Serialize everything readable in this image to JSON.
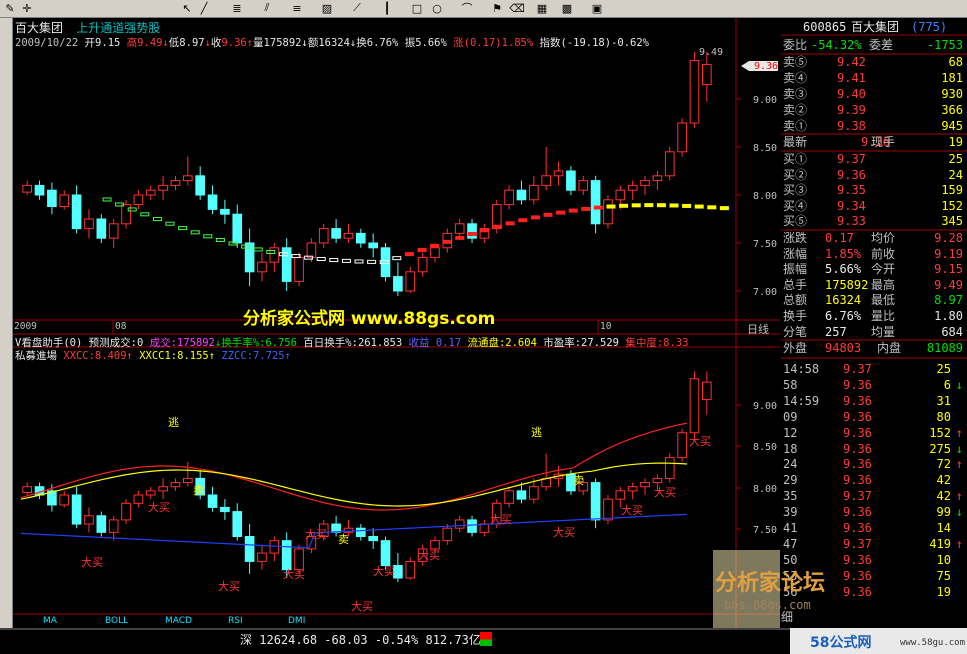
{
  "toolbar": {
    "icons": [
      "pencil-icon",
      "cross-icon",
      "arrow-icon",
      "line-icon",
      "cursor-icon",
      "diagonal-icon",
      "triangle-icon",
      "text-icon",
      "channel-icon",
      "parallel-icon",
      "hatch-icon",
      "bar-icon",
      "flag-icon",
      "rect-icon",
      "ellipse-icon",
      "arc-icon",
      "erase-icon",
      "palette-icon",
      "save-icon"
    ]
  },
  "main_chart": {
    "stock_name": "百大集团",
    "formula_name": "上升通道强势股",
    "info": {
      "date": "2009/10/22",
      "open_label": "开",
      "open": "9.15",
      "high_label": "高",
      "high": "9.49",
      "low_label": "低",
      "low": "8.97",
      "close_label": "收",
      "close": "9.36",
      "vol_label": "量",
      "vol": "175892",
      "amt_label": "额",
      "amt": "16324",
      "turn_label": "换",
      "turn": "6.76%",
      "amp_label": "振",
      "amp": "5.66%",
      "chg_label": "涨",
      "chg": "(0.17)",
      "chg_pct": "1.85%",
      "idx_label": "指数",
      "idx": "(-19.18)-0.62%"
    },
    "price_axis": [
      "9.00",
      "8.50",
      "8.00",
      "7.50",
      "7.00"
    ],
    "peak_label": "9.49",
    "current_tag": "9.36",
    "date_labels": [
      "2009",
      "08",
      "10"
    ],
    "period": "日线",
    "watermark": "分析家公式网 www.88gs.com"
  },
  "indicator_bar": {
    "name": "V看盘助手(0)",
    "forecast_label": "预测成交:0",
    "vol_label": "成交:175892",
    "turn_label": "换手率%:6.756",
    "avg100": "百日换手%:261.853",
    "close_label": "收益 0.17",
    "float_label": "流通盘:2.604",
    "pe_label": "市盈率:27.529",
    "conc_label": "集中度:8.33"
  },
  "lower_chart": {
    "name": "私募進場",
    "xxcc": "XXCC:8.409",
    "xxcc1": "XXCC1:8.155",
    "zzcc": "ZZCC:7.725",
    "price_axis": [
      "9.00",
      "8.50",
      "8.00",
      "7.50"
    ],
    "signals": {
      "buy": "大买",
      "sell": "卖",
      "escape": "逃"
    }
  },
  "tabs": [
    "MA",
    "BOLL",
    "MACD",
    "RSI",
    "DMI"
  ],
  "quote": {
    "code": "600865",
    "name": "百大集团",
    "num": "(775)",
    "weibi_label": "委比",
    "weibi": "-54.32%",
    "weicha_label": "委差",
    "weicha": "-1753",
    "sells": [
      {
        "l": "卖⑤",
        "p": "9.42",
        "v": "68"
      },
      {
        "l": "卖④",
        "p": "9.41",
        "v": "181"
      },
      {
        "l": "卖③",
        "p": "9.40",
        "v": "930"
      },
      {
        "l": "卖②",
        "p": "9.39",
        "v": "366"
      },
      {
        "l": "卖①",
        "p": "9.38",
        "v": "945"
      }
    ],
    "latest_label": "最新",
    "latest": "9.36",
    "xs_label": "现手",
    "xs": "19",
    "buys": [
      {
        "l": "买①",
        "p": "9.37",
        "v": "25"
      },
      {
        "l": "买②",
        "p": "9.36",
        "v": "24"
      },
      {
        "l": "买③",
        "p": "9.35",
        "v": "159"
      },
      {
        "l": "买④",
        "p": "9.34",
        "v": "152"
      },
      {
        "l": "买⑤",
        "p": "9.33",
        "v": "345"
      }
    ],
    "stats": [
      {
        "a": "涨跌",
        "b": "0.17",
        "c": "均价",
        "d": "9.28"
      },
      {
        "a": "涨幅",
        "b": "1.85%",
        "c": "前收",
        "d": "9.19"
      },
      {
        "a": "振幅",
        "b": "5.66%",
        "c": "今开",
        "d": "9.15"
      },
      {
        "a": "总手",
        "b": "175892",
        "c": "最高",
        "d": "9.49"
      },
      {
        "a": "总额",
        "b": "16324",
        "c": "最低",
        "d": "8.97"
      },
      {
        "a": "换手",
        "b": "6.76%",
        "c": "量比",
        "d": "1.80"
      },
      {
        "a": "分笔",
        "b": "257",
        "c": "均量",
        "d": "684"
      }
    ],
    "outer_label": "外盘",
    "outer": "94803",
    "inner_label": "内盘",
    "inner": "81089",
    "ticks": [
      {
        "t": "14:58",
        "p": "9.37",
        "v": "25",
        "d": ""
      },
      {
        "t": "58",
        "p": "9.36",
        "v": "6",
        "d": "↓"
      },
      {
        "t": "14:59",
        "p": "9.36",
        "v": "31",
        "d": ""
      },
      {
        "t": "09",
        "p": "9.36",
        "v": "80",
        "d": ""
      },
      {
        "t": "12",
        "p": "9.36",
        "v": "152",
        "d": "↑"
      },
      {
        "t": "18",
        "p": "9.36",
        "v": "275",
        "d": "↓"
      },
      {
        "t": "24",
        "p": "9.36",
        "v": "72",
        "d": "↑"
      },
      {
        "t": "29",
        "p": "9.36",
        "v": "42",
        "d": ""
      },
      {
        "t": "35",
        "p": "9.37",
        "v": "42",
        "d": "↑"
      },
      {
        "t": "39",
        "p": "9.36",
        "v": "99",
        "d": "↓"
      },
      {
        "t": "41",
        "p": "9.36",
        "v": "14",
        "d": ""
      },
      {
        "t": "47",
        "p": "9.37",
        "v": "419",
        "d": "↑"
      },
      {
        "t": "50",
        "p": "9.36",
        "v": "10",
        "d": ""
      },
      {
        "t": "53",
        "p": "9.36",
        "v": "75",
        "d": ""
      },
      {
        "t": "56",
        "p": "9.36",
        "v": "19",
        "d": ""
      }
    ],
    "detail_label": "细"
  },
  "bottom": {
    "market": "深",
    "index": "12624.68",
    "chg": "-68.03",
    "pct": "-0.54%",
    "amount": "812.73亿"
  },
  "logos": {
    "forum": "分析家论坛",
    "forum_url": "bbs.88gs.com",
    "site": "58公式网",
    "site_url": "www.58gu.com"
  }
}
